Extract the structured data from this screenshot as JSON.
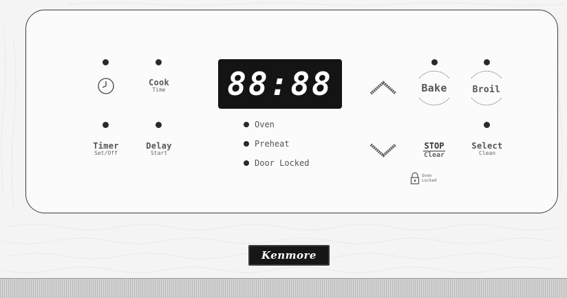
{
  "display": {
    "time": "88:88"
  },
  "controls": {
    "clock": {
      "icon": "clock-icon"
    },
    "cook_time": {
      "main": "Cook",
      "sub": "Time"
    },
    "timer": {
      "main": "Timer",
      "sub": "Set/Off"
    },
    "delay": {
      "main": "Delay",
      "sub": "Start"
    },
    "bake": {
      "main": "Bake"
    },
    "broil": {
      "main": "Broil"
    },
    "stop": {
      "main": "STOP",
      "sub": "Clear"
    },
    "select": {
      "main": "Select",
      "sub": "Clean"
    },
    "oven_locked": {
      "line1": "Oven",
      "line2": "Locked"
    }
  },
  "indicators": [
    {
      "label": "Oven"
    },
    {
      "label": "Preheat"
    },
    {
      "label": "Door Locked"
    }
  ],
  "arrows": {
    "up": "up-arrow-icon",
    "down": "down-arrow-icon"
  },
  "brand": {
    "name": "Kenmore"
  },
  "colors": {
    "panel_border": "#3b3b3b",
    "display_bg": "#141414",
    "display_text": "#ffffff"
  }
}
